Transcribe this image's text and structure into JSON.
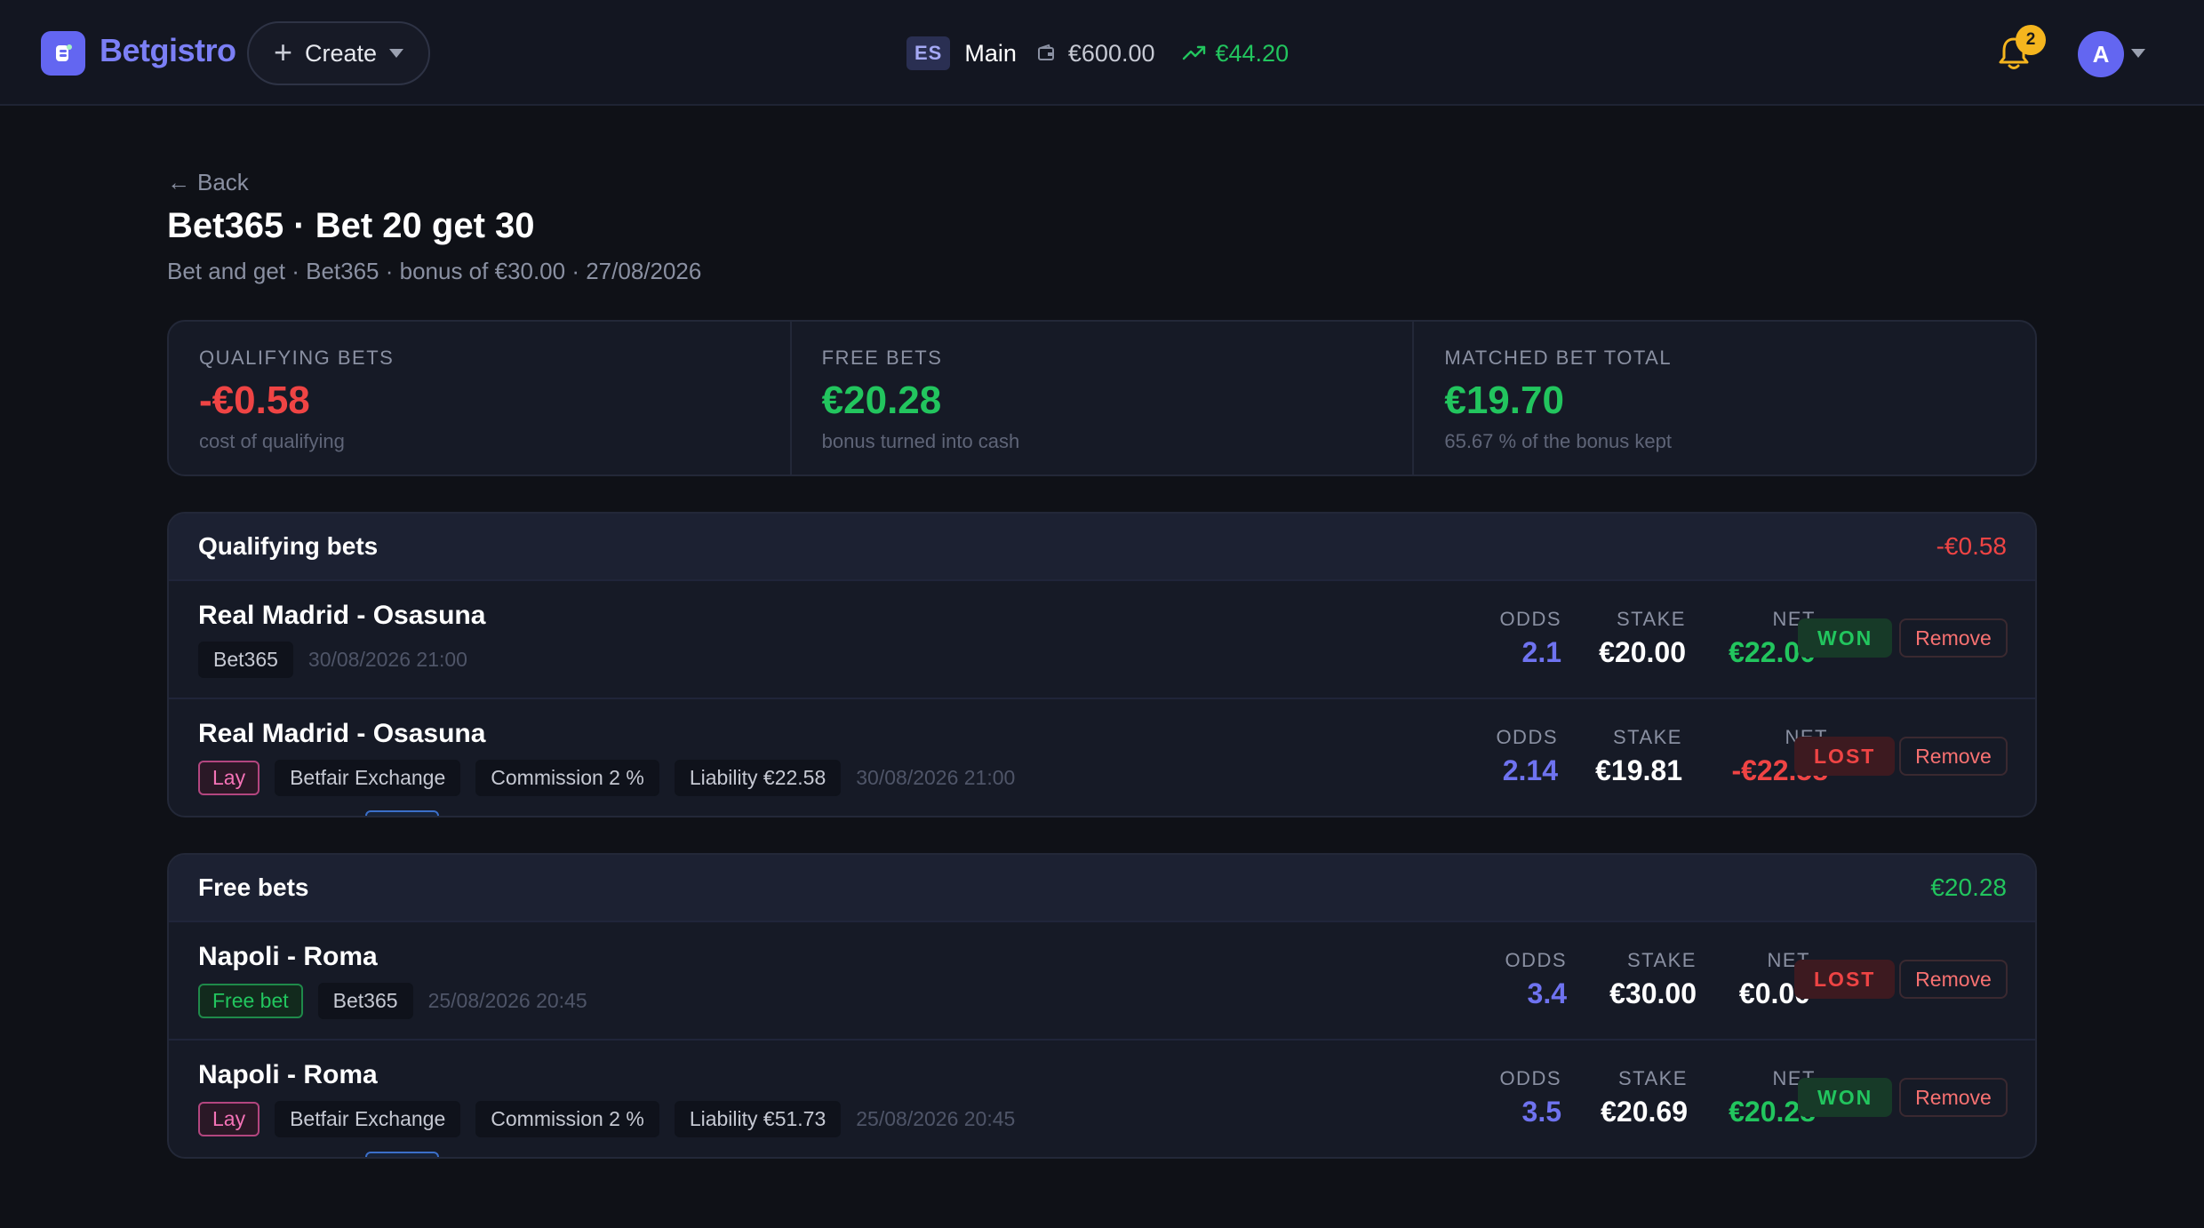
{
  "app": {
    "name": "Betgistro"
  },
  "topbar": {
    "create_label": "Create",
    "country_code": "ES",
    "account_name": "Main",
    "balance": "€600.00",
    "profit": "€44.20",
    "notifications_count": "2",
    "avatar_initial": "A"
  },
  "page": {
    "back_label": "Back",
    "title": "Bet365 · Bet 20 get 30",
    "subtitle": "Bet and get · Bet365 · bonus of €30.00 · 27/08/2026"
  },
  "summary": [
    {
      "label": "QUALIFYING BETS",
      "value": "-€0.58",
      "note": "cost of qualifying",
      "tone": "neg"
    },
    {
      "label": "FREE BETS",
      "value": "€20.28",
      "note": "bonus turned into cash",
      "tone": "pos"
    },
    {
      "label": "MATCHED BET TOTAL",
      "value": "€19.70",
      "note": "65.67 % of the bonus kept",
      "tone": "pos"
    }
  ],
  "labels": {
    "odds": "ODDS",
    "stake": "STAKE",
    "net": "NET",
    "remove": "Remove"
  },
  "sections": [
    {
      "title": "Qualifying bets",
      "total": "-€0.58",
      "bets": [
        {
          "event": "Real Madrid - Osasuna",
          "side": "Back",
          "tags": [
            "Bet365"
          ],
          "date": "30/08/2026 21:00",
          "odds": "2.1",
          "stake": "€20.00",
          "net": "€22.00",
          "result": "WON"
        },
        {
          "event": "Real Madrid - Osasuna",
          "side": "Lay",
          "tags": [
            "Betfair Exchange",
            "Commission 2 %",
            "Liability €22.58"
          ],
          "date": "30/08/2026 21:00",
          "odds": "2.14",
          "stake": "€19.81",
          "net": "-€22.58",
          "result": "LOST"
        }
      ]
    },
    {
      "title": "Free bets",
      "total": "€20.28",
      "bets": [
        {
          "event": "Napoli - Roma",
          "side": "Back",
          "free_bet": "Free bet",
          "tags": [
            "Bet365"
          ],
          "date": "25/08/2026 20:45",
          "odds": "3.4",
          "stake": "€30.00",
          "net": "€0.00",
          "result": "LOST"
        },
        {
          "event": "Napoli - Roma",
          "side": "Lay",
          "tags": [
            "Betfair Exchange",
            "Commission 2 %",
            "Liability €51.73"
          ],
          "date": "25/08/2026 20:45",
          "odds": "3.5",
          "stake": "€20.69",
          "net": "€20.28",
          "result": "WON"
        }
      ]
    }
  ],
  "colors": {
    "accent": "#6366f1",
    "positive": "#22c55e",
    "negative": "#ef4444",
    "background": "#0f1117"
  }
}
